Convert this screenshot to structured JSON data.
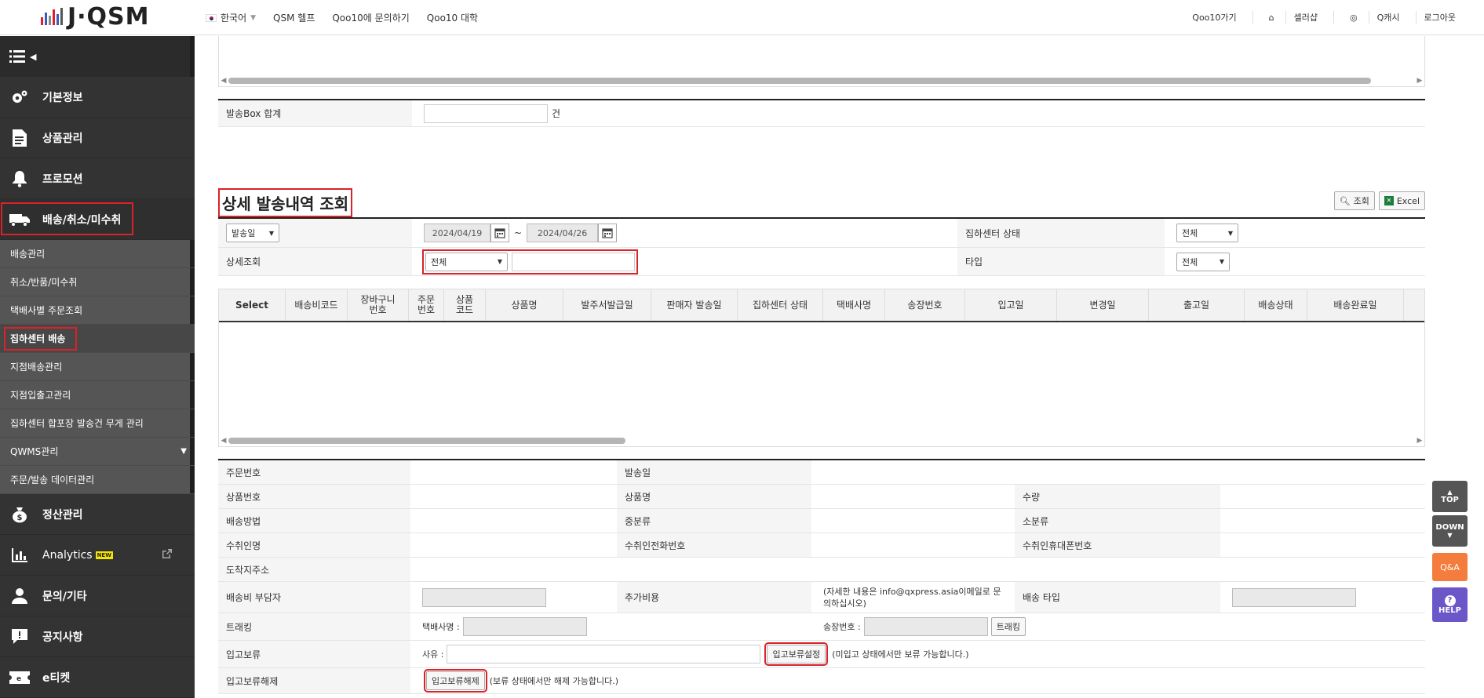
{
  "header": {
    "logo_text": "J·QSM",
    "language": "한국어",
    "links": [
      "QSM 헬프",
      "Qoo10에 문의하기",
      "Qoo10 대학"
    ],
    "right_links": [
      "Qoo10가기",
      "셀러샵",
      "Q캐시",
      "로그아웃"
    ]
  },
  "sidebar": {
    "main_items": [
      {
        "label": "기본정보",
        "icon": "gear-icon"
      },
      {
        "label": "상품관리",
        "icon": "document-icon"
      },
      {
        "label": "프로모션",
        "icon": "bell-icon"
      },
      {
        "label": "배송/취소/미수취",
        "icon": "truck-icon"
      }
    ],
    "sub_items": [
      "배송관리",
      "취소/반품/미수취",
      "택배사별 주문조회",
      "집하센터 배송",
      "지점배송관리",
      "지점입출고관리",
      "집하센터 합포장 발송건 무게 관리",
      "QWMS관리",
      "주문/발송 데이터관리"
    ],
    "bottom_items": [
      {
        "label": "정산관리",
        "icon": "money-bag-icon"
      },
      {
        "label": "Analytics",
        "icon": "chart-icon",
        "badge": "NEW"
      },
      {
        "label": "문의/기타",
        "icon": "person-icon"
      },
      {
        "label": "공지사항",
        "icon": "notice-icon"
      },
      {
        "label": "e티켓",
        "icon": "ticket-icon"
      }
    ]
  },
  "box_total": {
    "label": "발송Box 합계",
    "unit": "건",
    "value": ""
  },
  "section": {
    "title": "상세 발송내역 조회",
    "search_btn": "조회",
    "excel_btn": "Excel"
  },
  "filters": {
    "date_type": "발송일",
    "date_from": "2024/04/19",
    "date_to": "2024/04/26",
    "tilde": "~",
    "center_status_label": "집하센터 상태",
    "center_status": "전체",
    "detail_label": "상세조회",
    "detail_select": "전체",
    "type_label": "타입",
    "type_select": "전체"
  },
  "grid": {
    "columns": [
      "Select",
      "배송비코드",
      "장바구니\n번호",
      "주문\n번호",
      "상품\n코드",
      "상품명",
      "발주서발급일",
      "판매자 발송일",
      "집하센터 상태",
      "택배사명",
      "송장번호",
      "입고일",
      "변경일",
      "출고일",
      "배송상태",
      "배송완료일"
    ]
  },
  "detail": {
    "order_no": "주문번호",
    "ship_date": "발송일",
    "product_no": "상품번호",
    "product_name": "상품명",
    "quantity": "수량",
    "ship_method": "배송방법",
    "mid_category": "중분류",
    "sub_category": "소분류",
    "recipient": "수취인명",
    "recipient_phone": "수취인전화번호",
    "recipient_mobile": "수취인휴대폰번호",
    "address": "도착지주소",
    "fee_payer": "배송비 부담자",
    "extra_cost": "추가비용",
    "extra_note": "(자세한 내용은 info@qxpress.asia이메일로 문의하십시오)",
    "ship_type": "배송 타입",
    "tracking": "트래킹",
    "courier_label": "택배사명 :",
    "invoice_label": "송장번호 :",
    "tracking_btn": "트래킹",
    "hold": "입고보류",
    "reason_label": "사유 :",
    "hold_btn": "입고보류설정",
    "hold_note": "(미입고 상태에서만 보류 가능합니다.)",
    "release": "입고보류해제",
    "release_btn": "입고보류해제",
    "release_note": "(보류 상태에서만 해제 가능합니다.)"
  },
  "side_buttons": {
    "top": "TOP",
    "down": "DOWN",
    "qa": "Q&A",
    "help": "HELP"
  },
  "colors": {
    "accent_red": "#d9222a",
    "sidebar_bg": "#3b3b3b",
    "qa_orange": "#f47c3c",
    "help_purple": "#6b57c8"
  }
}
